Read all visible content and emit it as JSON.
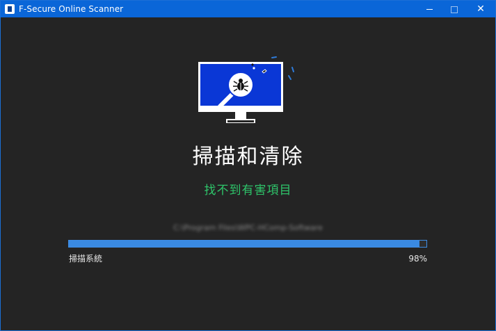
{
  "window": {
    "title": "F-Secure Online Scanner",
    "accent": "#0a66d8",
    "background": "#242424",
    "icons": [
      "app-icon",
      "minimize-icon",
      "maximize-icon",
      "close-icon"
    ]
  },
  "scan": {
    "headline": "掃描和清除",
    "status": "找不到有害項目",
    "status_color": "#2ec46a",
    "current_path": "C:\\Program Files\\WPC-HComp-Software",
    "progress_label": "掃描系統",
    "progress_text": "98%",
    "progress_value": 0.98,
    "illustration_icon": "monitor-bug-scan-icon"
  }
}
